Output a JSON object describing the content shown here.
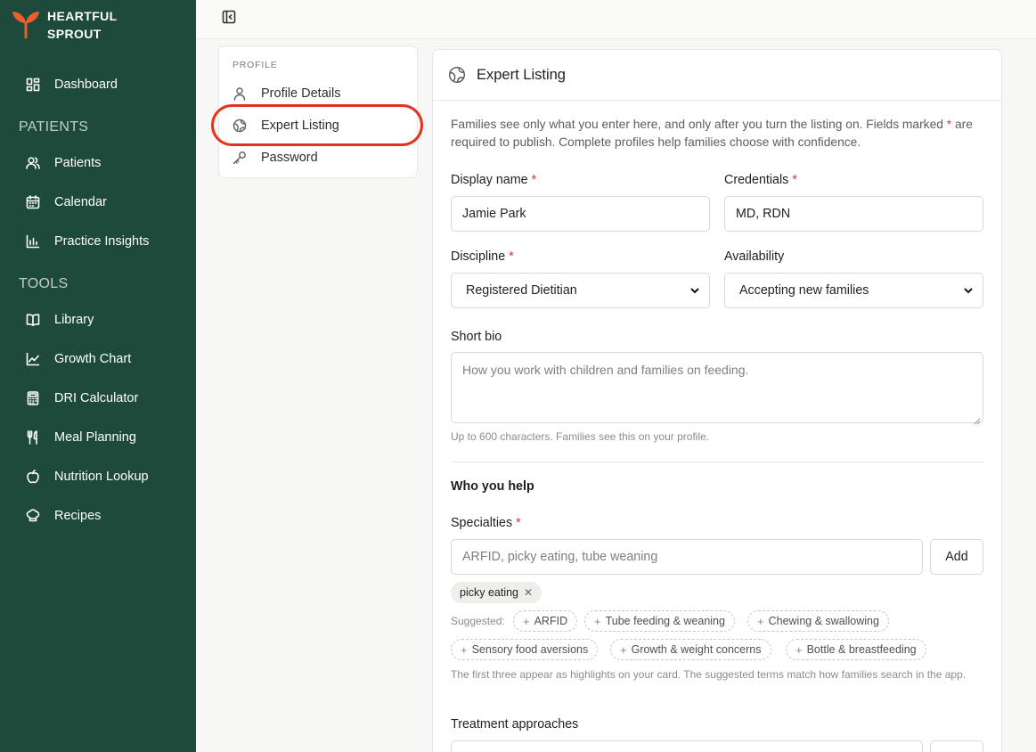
{
  "brand": {
    "line1": "HEARTFUL",
    "line2": "SPROUT",
    "icon": "sprout-icon",
    "accent": "#e8612c"
  },
  "sidebar": {
    "bg": "#1d4a3a",
    "dashboard": {
      "label": "Dashboard",
      "icon": "dashboard-icon"
    },
    "patients_section": "PATIENTS",
    "patients_items": [
      {
        "label": "Patients",
        "icon": "users-icon"
      },
      {
        "label": "Calendar",
        "icon": "calendar-icon"
      },
      {
        "label": "Practice Insights",
        "icon": "bar-chart-icon"
      }
    ],
    "tools_section": "TOOLS",
    "tools_items": [
      {
        "label": "Library",
        "icon": "book-icon"
      },
      {
        "label": "Growth Chart",
        "icon": "line-chart-icon"
      },
      {
        "label": "DRI Calculator",
        "icon": "calculator-icon"
      },
      {
        "label": "Meal Planning",
        "icon": "utensils-icon"
      },
      {
        "label": "Nutrition Lookup",
        "icon": "apple-icon"
      },
      {
        "label": "Recipes",
        "icon": "chef-hat-icon"
      }
    ]
  },
  "profile_nav": {
    "label": "PROFILE",
    "items": [
      {
        "label": "Profile Details",
        "icon": "user-icon"
      },
      {
        "label": "Expert Listing",
        "icon": "globe-icon"
      },
      {
        "label": "Password",
        "icon": "key-icon"
      }
    ]
  },
  "main": {
    "title": "Expert Listing",
    "intro_1": "Families see only what you enter here, and only after you turn the listing on. Fields marked",
    "intro_star": "*",
    "intro_2": "are required to publish. Complete profiles help families choose with confidence.",
    "display_name": {
      "label": "Display name",
      "value": "Jamie Park"
    },
    "credentials": {
      "label": "Credentials",
      "value": "MD, RDN"
    },
    "discipline": {
      "label": "Discipline",
      "value": "Registered Dietitian"
    },
    "availability": {
      "label": "Availability",
      "value": "Accepting new families"
    },
    "bio": {
      "label": "Short bio",
      "placeholder": "How you work with children and families on feeding.",
      "help": "Up to 600 characters. Families see this on your profile."
    },
    "section_title": "Who you help",
    "specialties": {
      "label": "Specialties",
      "placeholder": "ARFID, picky eating, tube weaning",
      "add_label": "Add",
      "selected": [
        "picky eating"
      ],
      "suggested_label": "Suggested:",
      "suggested": [
        "ARFID",
        "Tube feeding & weaning",
        "Chewing & swallowing",
        "Sensory food aversions",
        "Growth & weight concerns",
        "Bottle & breastfeeding"
      ],
      "help": "The first three appear as highlights on your card. The suggested terms match how families search in the app."
    },
    "treatment": {
      "label": "Treatment approaches"
    },
    "required_mark": "*",
    "required_color": "#d23a2a"
  }
}
